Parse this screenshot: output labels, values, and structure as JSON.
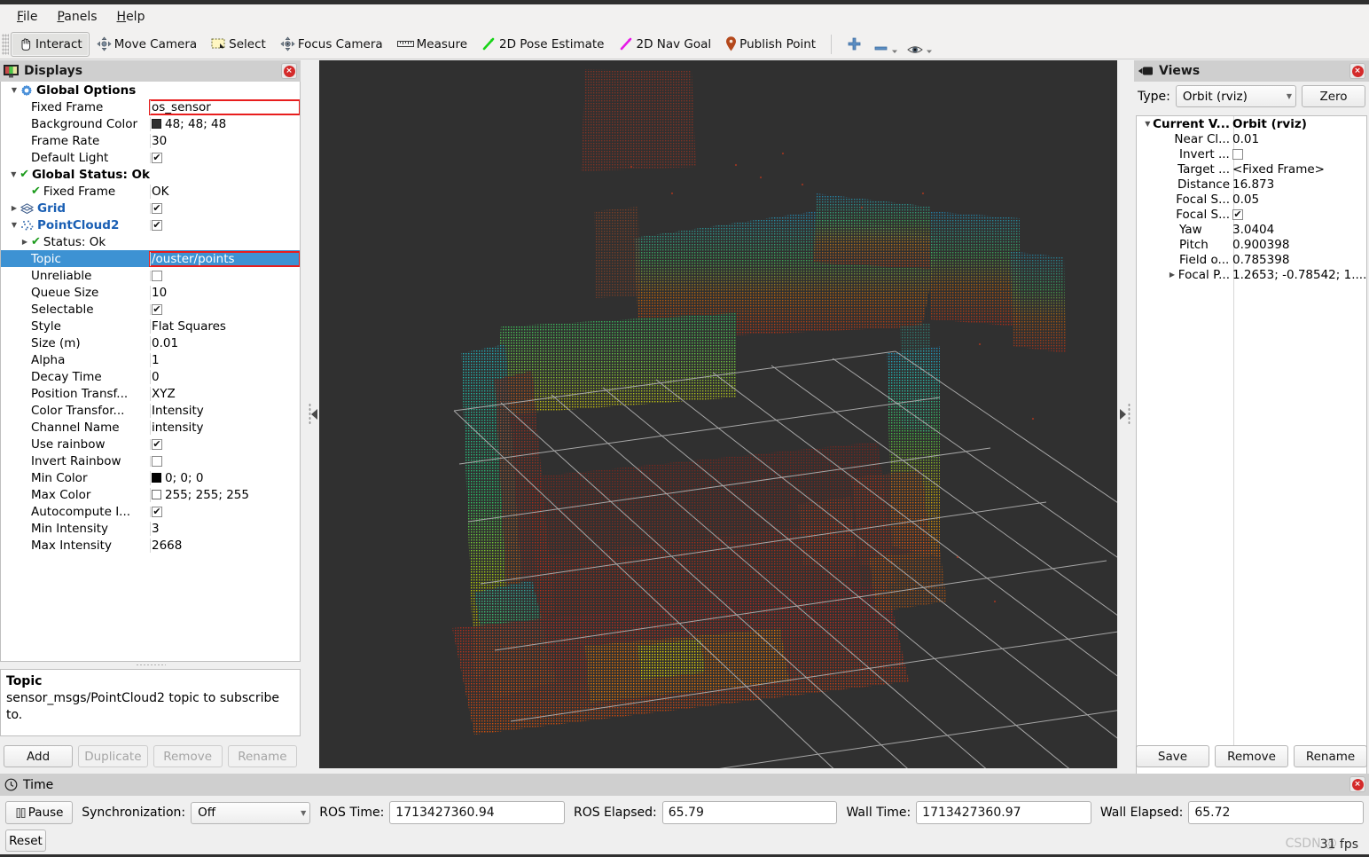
{
  "menu": {
    "items": [
      {
        "pre": "",
        "mn": "F",
        "post": "ile"
      },
      {
        "pre": "",
        "mn": "P",
        "post": "anels"
      },
      {
        "pre": "",
        "mn": "H",
        "post": "elp"
      }
    ]
  },
  "toolbar": {
    "interact": "Interact",
    "move_camera": "Move Camera",
    "select": "Select",
    "focus_camera": "Focus Camera",
    "measure": "Measure",
    "pose_estimate": "2D Pose Estimate",
    "nav_goal": "2D Nav Goal",
    "publish_point": "Publish Point"
  },
  "displays": {
    "title": "Displays",
    "rows": [
      {
        "indent": 0,
        "arrow": "down",
        "icon": "gear",
        "name": "Global Options",
        "bold": true,
        "blue": false,
        "value": "",
        "vtype": "none"
      },
      {
        "indent": 1,
        "arrow": "none",
        "icon": "none",
        "name": "Fixed Frame",
        "value": "os_sensor",
        "vtype": "text",
        "highlight": true
      },
      {
        "indent": 1,
        "arrow": "none",
        "icon": "none",
        "name": "Background Color",
        "value": "48; 48; 48",
        "vtype": "color-dark"
      },
      {
        "indent": 1,
        "arrow": "none",
        "icon": "none",
        "name": "Frame Rate",
        "value": "30",
        "vtype": "text"
      },
      {
        "indent": 1,
        "arrow": "none",
        "icon": "none",
        "name": "Default Light",
        "value": "",
        "vtype": "check-on"
      },
      {
        "indent": 0,
        "arrow": "down",
        "icon": "ok",
        "name": "Global Status: Ok",
        "bold": true,
        "value": "",
        "vtype": "none"
      },
      {
        "indent": 1,
        "arrow": "none",
        "icon": "ok",
        "name": "Fixed Frame",
        "value": "OK",
        "vtype": "text"
      },
      {
        "indent": 0,
        "arrow": "right",
        "icon": "grid",
        "name": "Grid",
        "blue": true,
        "bold": true,
        "value": "",
        "vtype": "check-on"
      },
      {
        "indent": 0,
        "arrow": "down",
        "icon": "points",
        "name": "PointCloud2",
        "blue": true,
        "bold": true,
        "value": "",
        "vtype": "check-on"
      },
      {
        "indent": 1,
        "arrow": "right",
        "icon": "ok",
        "name": "Status: Ok",
        "value": "",
        "vtype": "none"
      },
      {
        "indent": 1,
        "arrow": "none",
        "icon": "none",
        "name": "Topic",
        "value": "/ouster/points",
        "vtype": "text",
        "selected": true,
        "highlight": true
      },
      {
        "indent": 1,
        "arrow": "none",
        "icon": "none",
        "name": "Unreliable",
        "value": "",
        "vtype": "check-off"
      },
      {
        "indent": 1,
        "arrow": "none",
        "icon": "none",
        "name": "Queue Size",
        "value": "10",
        "vtype": "text"
      },
      {
        "indent": 1,
        "arrow": "none",
        "icon": "none",
        "name": "Selectable",
        "value": "",
        "vtype": "check-on"
      },
      {
        "indent": 1,
        "arrow": "none",
        "icon": "none",
        "name": "Style",
        "value": "Flat Squares",
        "vtype": "text"
      },
      {
        "indent": 1,
        "arrow": "none",
        "icon": "none",
        "name": "Size (m)",
        "value": "0.01",
        "vtype": "text"
      },
      {
        "indent": 1,
        "arrow": "none",
        "icon": "none",
        "name": "Alpha",
        "value": "1",
        "vtype": "text"
      },
      {
        "indent": 1,
        "arrow": "none",
        "icon": "none",
        "name": "Decay Time",
        "value": "0",
        "vtype": "text"
      },
      {
        "indent": 1,
        "arrow": "none",
        "icon": "none",
        "name": "Position Transf...",
        "value": "XYZ",
        "vtype": "text"
      },
      {
        "indent": 1,
        "arrow": "none",
        "icon": "none",
        "name": "Color Transfor...",
        "value": "Intensity",
        "vtype": "text"
      },
      {
        "indent": 1,
        "arrow": "none",
        "icon": "none",
        "name": "Channel Name",
        "value": "intensity",
        "vtype": "text"
      },
      {
        "indent": 1,
        "arrow": "none",
        "icon": "none",
        "name": "Use rainbow",
        "value": "",
        "vtype": "check-on"
      },
      {
        "indent": 1,
        "arrow": "none",
        "icon": "none",
        "name": "Invert Rainbow",
        "value": "",
        "vtype": "check-off"
      },
      {
        "indent": 1,
        "arrow": "none",
        "icon": "none",
        "name": "Min Color",
        "value": "0; 0; 0",
        "vtype": "color-black"
      },
      {
        "indent": 1,
        "arrow": "none",
        "icon": "none",
        "name": "Max Color",
        "value": "255; 255; 255",
        "vtype": "color-white"
      },
      {
        "indent": 1,
        "arrow": "none",
        "icon": "none",
        "name": "Autocompute I...",
        "value": "",
        "vtype": "check-on"
      },
      {
        "indent": 1,
        "arrow": "none",
        "icon": "none",
        "name": "Min Intensity",
        "value": "3",
        "vtype": "text"
      },
      {
        "indent": 1,
        "arrow": "none",
        "icon": "none",
        "name": "Max Intensity",
        "value": "2668",
        "vtype": "text"
      }
    ],
    "help_title": "Topic",
    "help_text": "sensor_msgs/PointCloud2 topic to subscribe to.",
    "buttons": [
      {
        "label": "Add",
        "disabled": false
      },
      {
        "label": "Duplicate",
        "disabled": true
      },
      {
        "label": "Remove",
        "disabled": true
      },
      {
        "label": "Rename",
        "disabled": true
      }
    ]
  },
  "views": {
    "title": "Views",
    "type_label": "Type:",
    "type_value": "Orbit (rviz)",
    "zero_label": "Zero",
    "rows": [
      {
        "indent": 0,
        "arrow": "down",
        "name": "Current V...",
        "bold": true,
        "value": "Orbit (rviz)",
        "vtype": "text",
        "bold_value": true
      },
      {
        "indent": 1,
        "arrow": "none",
        "name": "Near Cl...",
        "value": "0.01",
        "vtype": "text"
      },
      {
        "indent": 1,
        "arrow": "none",
        "name": "Invert ...",
        "value": "",
        "vtype": "check-off"
      },
      {
        "indent": 1,
        "arrow": "none",
        "name": "Target ...",
        "value": "<Fixed Frame>",
        "vtype": "text"
      },
      {
        "indent": 1,
        "arrow": "none",
        "name": "Distance",
        "value": "16.873",
        "vtype": "text"
      },
      {
        "indent": 1,
        "arrow": "none",
        "name": "Focal S...",
        "value": "0.05",
        "vtype": "text"
      },
      {
        "indent": 1,
        "arrow": "none",
        "name": "Focal S...",
        "value": "",
        "vtype": "check-on"
      },
      {
        "indent": 1,
        "arrow": "none",
        "name": "Yaw",
        "value": "3.0404",
        "vtype": "text"
      },
      {
        "indent": 1,
        "arrow": "none",
        "name": "Pitch",
        "value": "0.900398",
        "vtype": "text"
      },
      {
        "indent": 1,
        "arrow": "none",
        "name": "Field o...",
        "value": "0.785398",
        "vtype": "text"
      },
      {
        "indent": 1,
        "arrow": "right",
        "name": "Focal P...",
        "value": "1.2653; -0.78542; 1....",
        "vtype": "text"
      }
    ],
    "buttons": [
      {
        "label": "Save"
      },
      {
        "label": "Remove"
      },
      {
        "label": "Rename"
      }
    ]
  },
  "time": {
    "title": "Time",
    "pause_label": "Pause",
    "sync_label": "Synchronization:",
    "sync_value": "Off",
    "ros_time_label": "ROS Time:",
    "ros_time_value": "1713427360.94",
    "ros_elapsed_label": "ROS Elapsed:",
    "ros_elapsed_value": "65.79",
    "wall_time_label": "Wall Time:",
    "wall_time_value": "1713427360.97",
    "wall_elapsed_label": "Wall Elapsed:",
    "wall_elapsed_value": "65.72",
    "reset_label": "Reset",
    "fps": "31 fps",
    "watermark": "CSDN @"
  },
  "viewport": {
    "background_color": "#303030",
    "grid_color": "#b4b4b4",
    "point_cloud_topic": "/ouster/points",
    "color_transformer": "Intensity"
  }
}
